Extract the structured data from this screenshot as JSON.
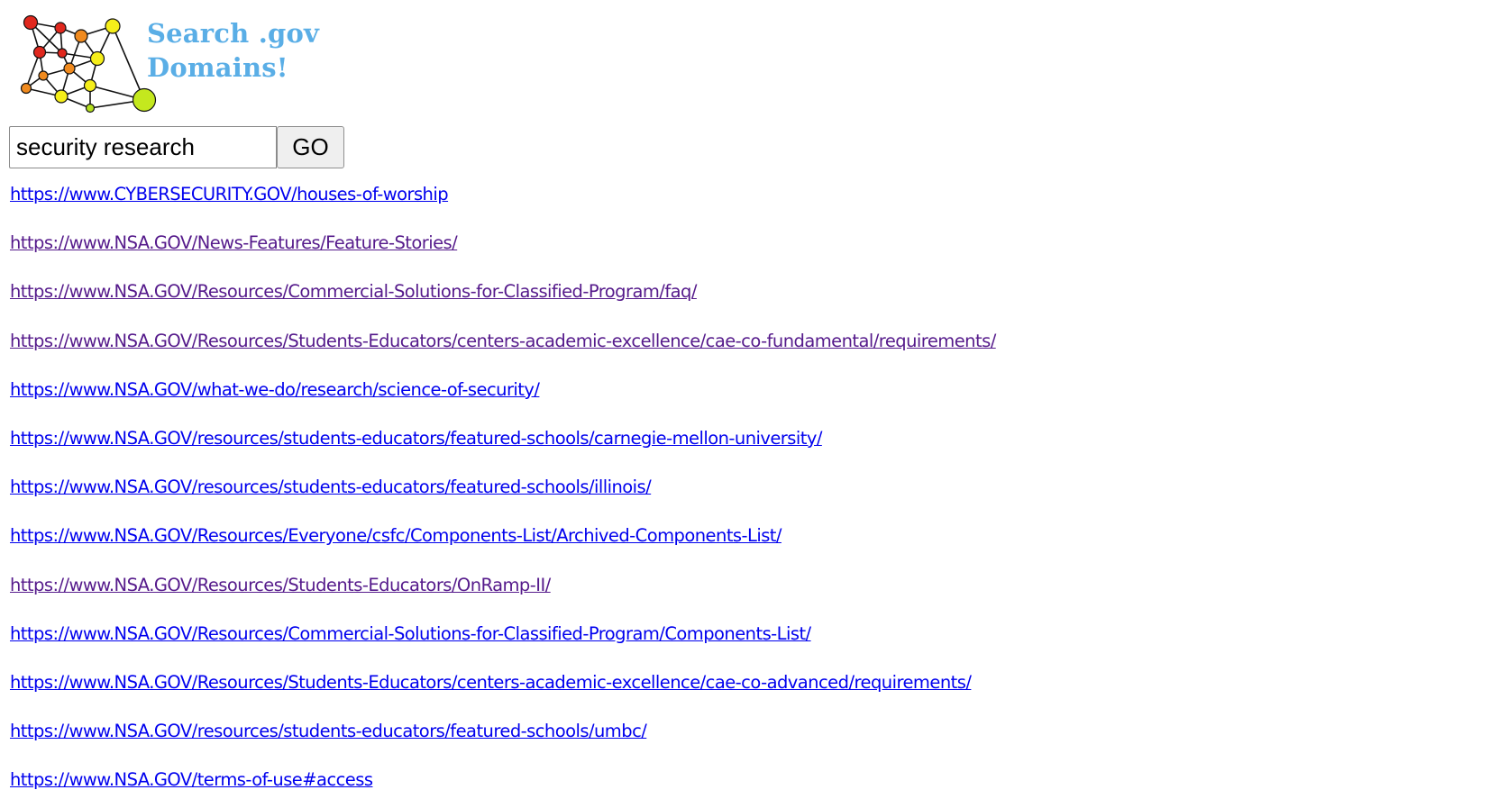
{
  "logo": {
    "title_line1": "Search .gov",
    "title_line2": "Domains!",
    "icon_name": "network-graph-icon",
    "title_color": "#5aaee6"
  },
  "search": {
    "query": "security research",
    "go_label": "GO"
  },
  "colors": {
    "link": "#0000ee",
    "visited_link": "#551a8b"
  },
  "results": [
    {
      "url": "https://www.CYBERSECURITY.GOV/houses-of-worship",
      "visited": false
    },
    {
      "url": "https://www.NSA.GOV/News-Features/Feature-Stories/",
      "visited": true
    },
    {
      "url": "https://www.NSA.GOV/Resources/Commercial-Solutions-for-Classified-Program/faq/",
      "visited": true
    },
    {
      "url": "https://www.NSA.GOV/Resources/Students-Educators/centers-academic-excellence/cae-co-fundamental/requirements/",
      "visited": true
    },
    {
      "url": "https://www.NSA.GOV/what-we-do/research/science-of-security/",
      "visited": false
    },
    {
      "url": "https://www.NSA.GOV/resources/students-educators/featured-schools/carnegie-mellon-university/",
      "visited": false
    },
    {
      "url": "https://www.NSA.GOV/resources/students-educators/featured-schools/illinois/",
      "visited": false
    },
    {
      "url": "https://www.NSA.GOV/Resources/Everyone/csfc/Components-List/Archived-Components-List/",
      "visited": false
    },
    {
      "url": "https://www.NSA.GOV/Resources/Students-Educators/OnRamp-II/",
      "visited": true
    },
    {
      "url": "https://www.NSA.GOV/Resources/Commercial-Solutions-for-Classified-Program/Components-List/",
      "visited": false
    },
    {
      "url": "https://www.NSA.GOV/Resources/Students-Educators/centers-academic-excellence/cae-co-advanced/requirements/",
      "visited": false
    },
    {
      "url": "https://www.NSA.GOV/resources/students-educators/featured-schools/umbc/",
      "visited": false
    },
    {
      "url": "https://www.NSA.GOV/terms-of-use#access",
      "visited": false
    }
  ]
}
